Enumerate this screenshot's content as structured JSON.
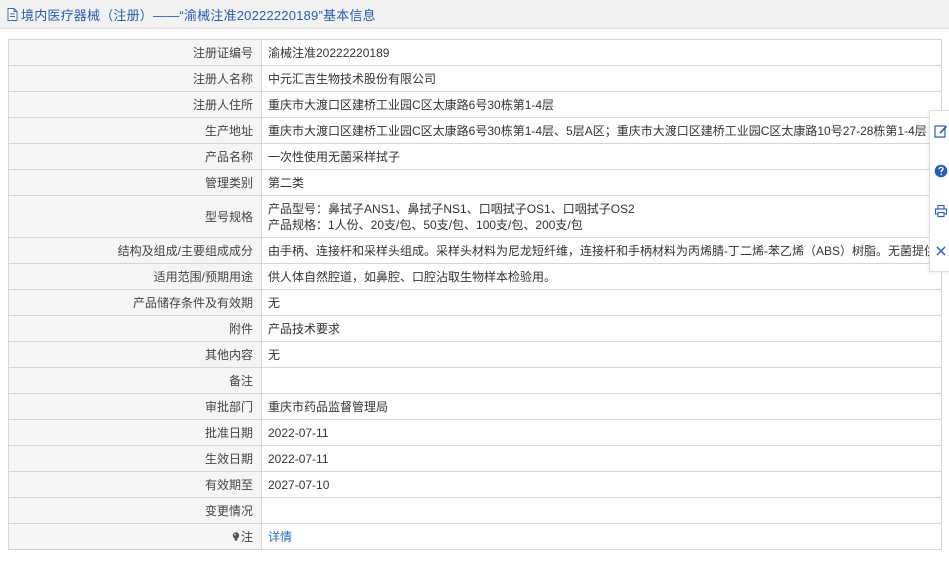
{
  "header": {
    "title": "境内医疗器械（注册）——“渝械注准20222220189”基本信息"
  },
  "rows": [
    {
      "label": "注册证编号",
      "value": "渝械注准20222220189"
    },
    {
      "label": "注册人名称",
      "value": "中元汇吉生物技术股份有限公司"
    },
    {
      "label": "注册人住所",
      "value": "重庆市大渡口区建桥工业园C区太康路6号30栋第1-4层"
    },
    {
      "label": "生产地址",
      "value": "重庆市大渡口区建桥工业园C区太康路6号30栋第1-4层、5层A区；重庆市大渡口区建桥工业园C区太康路10号27-28栋第1-4层"
    },
    {
      "label": "产品名称",
      "value": "一次性使用无菌采样拭子"
    },
    {
      "label": "管理类别",
      "value": "第二类"
    },
    {
      "label": "型号规格",
      "value_lines": [
        "产品型号：鼻拭子ANS1、鼻拭子NS1、口咽拭子OS1、口咽拭子OS2",
        "产品规格：1人份、20支/包、50支/包、100支/包、200支/包"
      ]
    },
    {
      "label": "结构及组成/主要组成成分",
      "value": "由手柄、连接杆和采样头组成。采样头材料为尼龙短纤维，连接杆和手柄材料为丙烯腈-丁二烯-苯乙烯（ABS）树脂。无菌提供。"
    },
    {
      "label": "适用范围/预期用途",
      "value": "供人体自然腔道，如鼻腔、口腔沾取生物样本检验用。"
    },
    {
      "label": "产品储存条件及有效期",
      "value": "无"
    },
    {
      "label": "附件",
      "value": "产品技术要求"
    },
    {
      "label": "其他内容",
      "value": "无"
    },
    {
      "label": "备注",
      "value": ""
    },
    {
      "label": "审批部门",
      "value": "重庆市药品监督管理局"
    },
    {
      "label": "批准日期",
      "value": "2022-07-11"
    },
    {
      "label": "生效日期",
      "value": "2022-07-11"
    },
    {
      "label": "有效期至",
      "value": "2027-07-10"
    },
    {
      "label": "变更情况",
      "value": ""
    },
    {
      "label": "注",
      "value": "详情"
    }
  ],
  "sidebar": {
    "tools": [
      "edit-icon",
      "help-icon",
      "print-icon",
      "close-icon"
    ]
  },
  "colors": {
    "title": "#2a5ea8",
    "label_bg": "#f5f5f5",
    "border": "#d6d6d6",
    "link": "#2a6cc0"
  }
}
